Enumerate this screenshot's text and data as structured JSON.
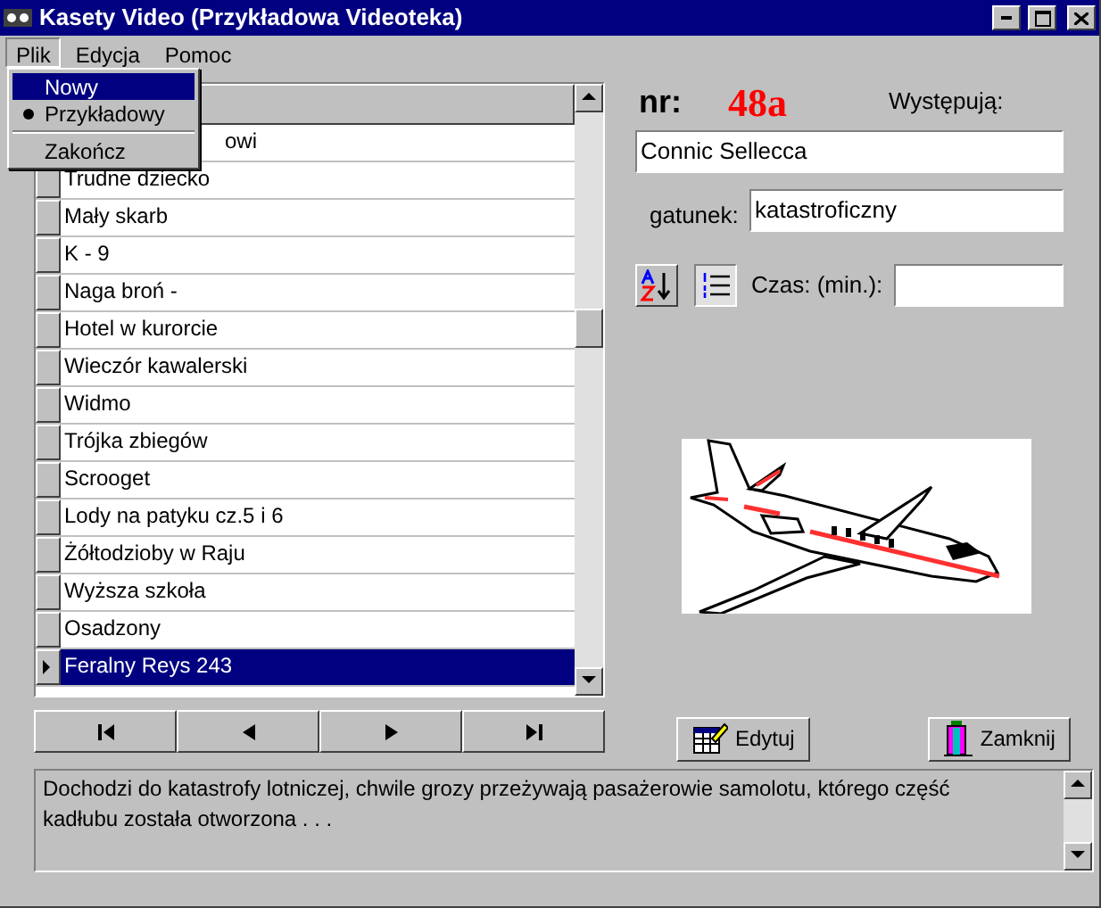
{
  "window": {
    "title": "Kasety Video (Przykładowa Videoteka)"
  },
  "menu": [
    {
      "label": "Plik",
      "selected": true
    },
    {
      "label": "Edycja",
      "selected": false
    },
    {
      "label": "Pomoc",
      "selected": false
    }
  ],
  "open_menu": {
    "items": [
      {
        "kind": "item",
        "label": "Nowy",
        "selected": true,
        "checked": false
      },
      {
        "kind": "item",
        "label": "Przykładowy",
        "selected": false,
        "checked": true
      },
      {
        "kind": "separator"
      },
      {
        "kind": "item",
        "label": "Zakończ",
        "selected": false,
        "checked": false
      }
    ]
  },
  "grid": {
    "rows": [
      {
        "title": "owi",
        "clipped": true,
        "selected": false
      },
      {
        "title": "Trudne dziecko",
        "clipped": false,
        "selected": false
      },
      {
        "title": "Mały skarb",
        "clipped": false,
        "selected": false
      },
      {
        "title": "K - 9",
        "clipped": false,
        "selected": false
      },
      {
        "title": "Naga broń -",
        "clipped": false,
        "selected": false
      },
      {
        "title": "Hotel w kurorcie",
        "clipped": false,
        "selected": false
      },
      {
        "title": "Wieczór kawalerski",
        "clipped": false,
        "selected": false
      },
      {
        "title": "Widmo",
        "clipped": false,
        "selected": false
      },
      {
        "title": "Trójka zbiegów",
        "clipped": false,
        "selected": false
      },
      {
        "title": "Scrooget",
        "clipped": false,
        "selected": false
      },
      {
        "title": "Lody na patyku  cz.5 i 6",
        "clipped": false,
        "selected": false
      },
      {
        "title": "Żółtodzioby w Raju",
        "clipped": false,
        "selected": false
      },
      {
        "title": "Wyższa szkoła",
        "clipped": false,
        "selected": false
      },
      {
        "title": "Osadzony",
        "clipped": false,
        "selected": false
      },
      {
        "title": "Feralny Reys 243",
        "clipped": false,
        "selected": true
      }
    ]
  },
  "record": {
    "number_label": "nr:",
    "number": "48a",
    "cast_label": "Występują:",
    "cast": "Connic Sellecca",
    "genre_label": "gatunek:",
    "genre": "katastroficzny",
    "duration_label": "Czas: (min.):"
  },
  "navigation": [
    {
      "kind": "first"
    },
    {
      "kind": "prev"
    },
    {
      "kind": "next"
    },
    {
      "kind": "last"
    }
  ],
  "buttons": [
    {
      "kind": "edit",
      "label": "Edytuj"
    },
    {
      "kind": "close",
      "label": "Zamknij"
    }
  ],
  "description": "Dochodzi do katastrofy lotniczej, chwile grozy przeżywają pasażerowie samolotu, którego część kadłubu została otworzona . . ."
}
